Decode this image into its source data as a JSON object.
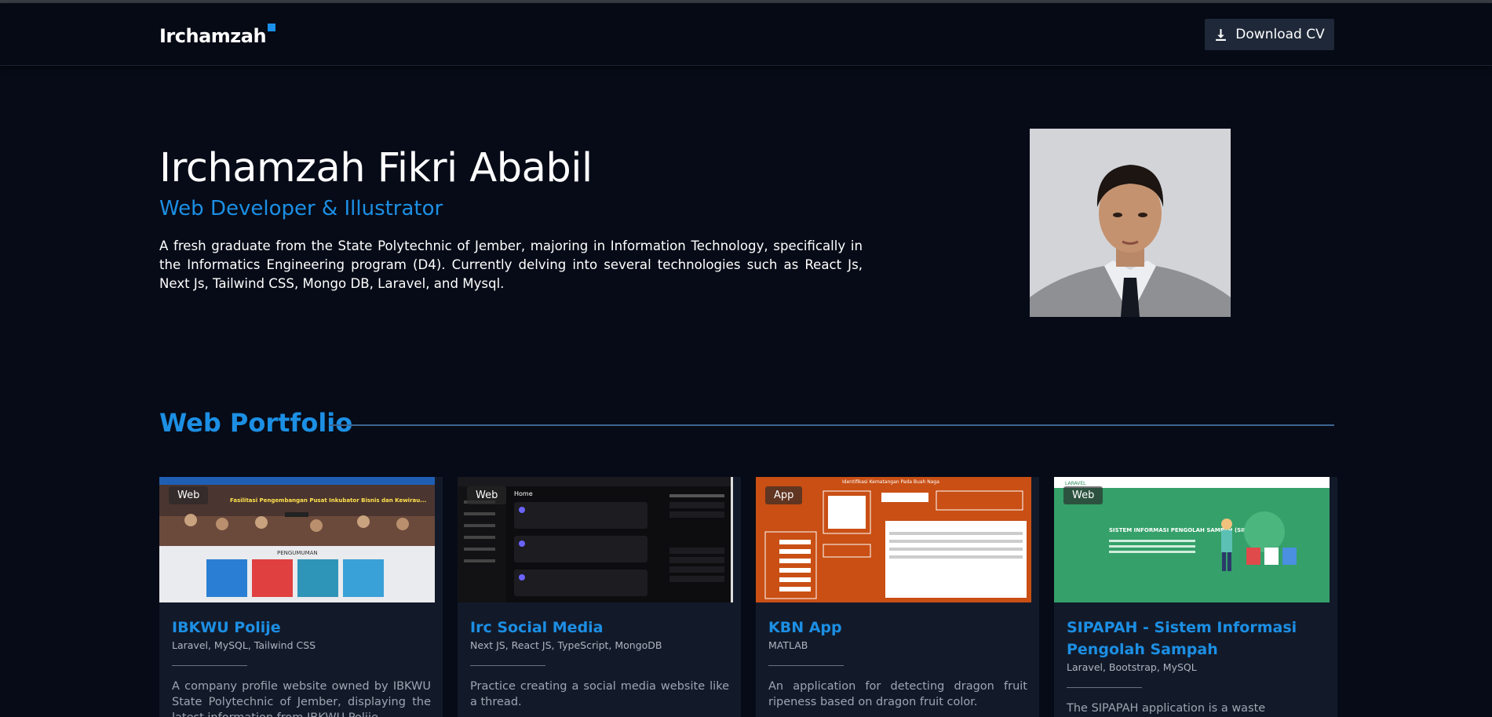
{
  "nav": {
    "logo": "Irchamzah",
    "download_label": "Download CV"
  },
  "hero": {
    "name": "Irchamzah Fikri Ababil",
    "role": "Web Developer & Illustrator",
    "description": "A fresh graduate from the State Polytechnic of Jember, majoring in Information Technology, specifically in the Informatics Engineering program (D4). Currently delving into several technologies such as React Js, Next Js, Tailwind CSS, Mongo DB, Laravel, and Mysql."
  },
  "portfolio": {
    "title": "Web Portfolio",
    "cards": [
      {
        "badge": "Web",
        "title": "IBKWU Polije",
        "tech": "Laravel, MySQL, Tailwind CSS",
        "description": "A company profile website owned by IBKWU State Polytechnic of Jember, displaying the latest information from IBKWU Polije.",
        "thumb": {
          "headline": "Fasilitasi Pengembangan Pusat Inkubator Bisnis dan Kewirau...",
          "section": "PENGUMUMAN"
        }
      },
      {
        "badge": "Web",
        "title": "Irc Social Media",
        "tech": "Next JS, React JS, TypeScript, MongoDB",
        "description": "Practice creating a social media website like a thread.",
        "thumb": {
          "header": "Home"
        }
      },
      {
        "badge": "App",
        "title": "KBN App",
        "tech": "MATLAB",
        "description": "An application for detecting dragon fruit ripeness based on dragon fruit color.",
        "thumb": {
          "header": "Identifikasi Kematangan Pada Buah Naga"
        }
      },
      {
        "badge": "Web",
        "title": "SIPAPAH - Sistem Informasi Pengolah Sampah",
        "tech": "Laravel, Bootstrap, MySQL",
        "description": "The SIPAPAH application is a waste",
        "thumb": {
          "brand": "LARAVEL",
          "headline": "SISTEM INFORMASI PENGOLAH SAMPAH (SIPAPAH)"
        }
      }
    ]
  }
}
